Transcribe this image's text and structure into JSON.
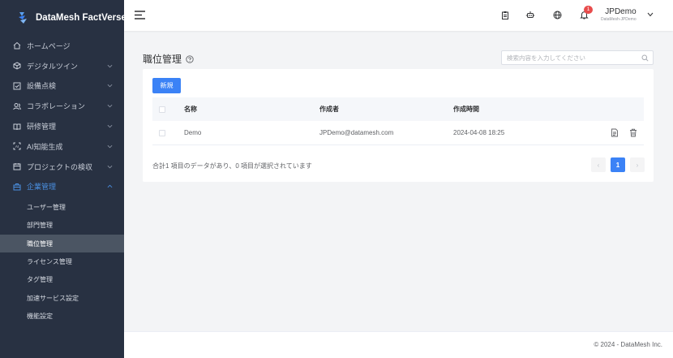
{
  "app": {
    "title": "DataMesh FactVerse"
  },
  "sidebar": {
    "items": [
      {
        "label": "ホームページ",
        "icon": "home-icon",
        "has_children": false
      },
      {
        "label": "デジタルツイン",
        "icon": "cube-icon",
        "has_children": true
      },
      {
        "label": "設備点検",
        "icon": "checklist-icon",
        "has_children": true
      },
      {
        "label": "コラボレーション",
        "icon": "users-icon",
        "has_children": true
      },
      {
        "label": "研修管理",
        "icon": "book-icon",
        "has_children": true
      },
      {
        "label": "AI知能生成",
        "icon": "ai-icon",
        "has_children": true
      },
      {
        "label": "プロジェクトの検収",
        "icon": "calendar-icon",
        "has_children": true
      },
      {
        "label": "企業管理",
        "icon": "briefcase-icon",
        "has_children": true,
        "active": true
      }
    ],
    "submenu": [
      {
        "label": "ユーザー管理"
      },
      {
        "label": "部門管理"
      },
      {
        "label": "職位管理",
        "selected": true
      },
      {
        "label": "ライセンス管理"
      },
      {
        "label": "タグ管理"
      },
      {
        "label": "加速サービス設定"
      },
      {
        "label": "機能設定"
      }
    ]
  },
  "header": {
    "notification_count": "1",
    "user_name": "JPDemo",
    "user_org": "DataMesh-JPDemo",
    "icons": [
      "clipboard-icon",
      "robot-icon",
      "globe-icon",
      "bell-icon"
    ]
  },
  "main": {
    "page_title": "職位管理",
    "search_placeholder": "検索内容を入力してください",
    "new_button": "新規",
    "table": {
      "headers": {
        "name": "名称",
        "creator": "作成者",
        "time": "作成時間"
      },
      "rows": [
        {
          "name": "Demo",
          "creator": "JPDemo@datamesh.com",
          "time": "2024-04-08 18:25"
        }
      ]
    },
    "summary": "合計1 項目のデータがあり、0 項目が選択されています",
    "pagination": {
      "prev": "‹",
      "current": "1",
      "next": "›"
    }
  },
  "footer": {
    "copyright": "© 2024 - DataMesh Inc."
  },
  "colors": {
    "sidebar_bg": "#283142",
    "accent": "#3b82f6",
    "active_menu": "#4a8fe0",
    "badge": "#e84c4c"
  }
}
